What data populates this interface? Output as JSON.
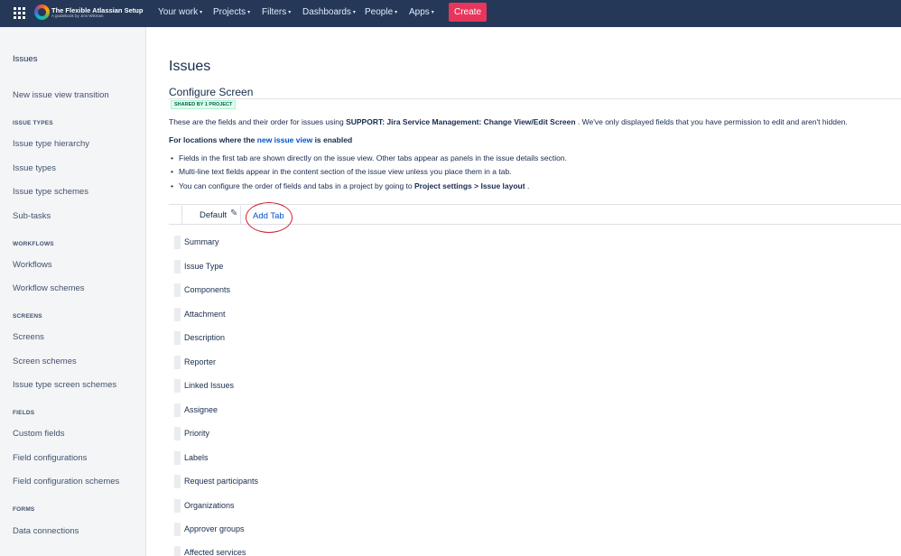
{
  "topnav": {
    "logo_title": "The Flexible Atlassian Setup",
    "logo_subtitle": "A guidebook by Jimi Wikman",
    "items": [
      {
        "label": "Your work",
        "chevron": "chevron-down-icon"
      },
      {
        "label": "Projects",
        "chevron": "chevron-down-icon"
      },
      {
        "label": "Filters",
        "chevron": "chevron-down-icon"
      },
      {
        "label": "Dashboards",
        "chevron": "chevron-down-icon"
      },
      {
        "label": "People",
        "chevron": "chevron-down-icon"
      },
      {
        "label": "Apps",
        "chevron": "chevron-down-icon"
      }
    ],
    "create_label": "Create",
    "colors": {
      "bar": "#253858",
      "create": "#e8355b"
    }
  },
  "sidebar": {
    "title": "Issues",
    "top_link": "New issue view transition",
    "sections": [
      {
        "heading": "ISSUE TYPES",
        "items": [
          "Issue type hierarchy",
          "Issue types",
          "Issue type schemes",
          "Sub-tasks"
        ]
      },
      {
        "heading": "WORKFLOWS",
        "items": [
          "Workflows",
          "Workflow schemes"
        ]
      },
      {
        "heading": "SCREENS",
        "items": [
          "Screens",
          "Screen schemes",
          "Issue type screen schemes"
        ]
      },
      {
        "heading": "FIELDS",
        "items": [
          "Custom fields",
          "Field configurations",
          "Field configuration schemes"
        ]
      },
      {
        "heading": "FORMS",
        "items": [
          "Data connections"
        ]
      }
    ]
  },
  "main": {
    "page_title": "Issues",
    "section_title": "Configure Screen",
    "shared_badge": "SHARED BY 1 PROJECT",
    "description": {
      "before": "These are the fields and their order for issues using ",
      "screen_name": "SUPPORT: Jira Service Management: Change View/Edit Screen",
      "after": " . We've only displayed fields that you have permission to edit and aren't hidden."
    },
    "locations": {
      "before": "For locations where the ",
      "link": "new issue view",
      "after": " is enabled"
    },
    "bullets": {
      "first": "Fields in the first tab are shown directly on the issue view. Other tabs appear as panels in the issue details section.",
      "second": "Multi-line text fields appear in the content section of the issue view unless you place them in a tab.",
      "third_before": "You can configure the order of fields and tabs in a project by going to ",
      "third_bold": "Project settings > Issue layout",
      "third_after": " ."
    },
    "tabs": {
      "default_label": "Default",
      "edit_icon": "pencil-icon",
      "add_tab_label": "Add Tab"
    },
    "fields": [
      "Summary",
      "Issue Type",
      "Components",
      "Attachment",
      "Description",
      "Reporter",
      "Linked Issues",
      "Assignee",
      "Priority",
      "Labels",
      "Request participants",
      "Organizations",
      "Approver groups",
      "Affected services"
    ]
  }
}
